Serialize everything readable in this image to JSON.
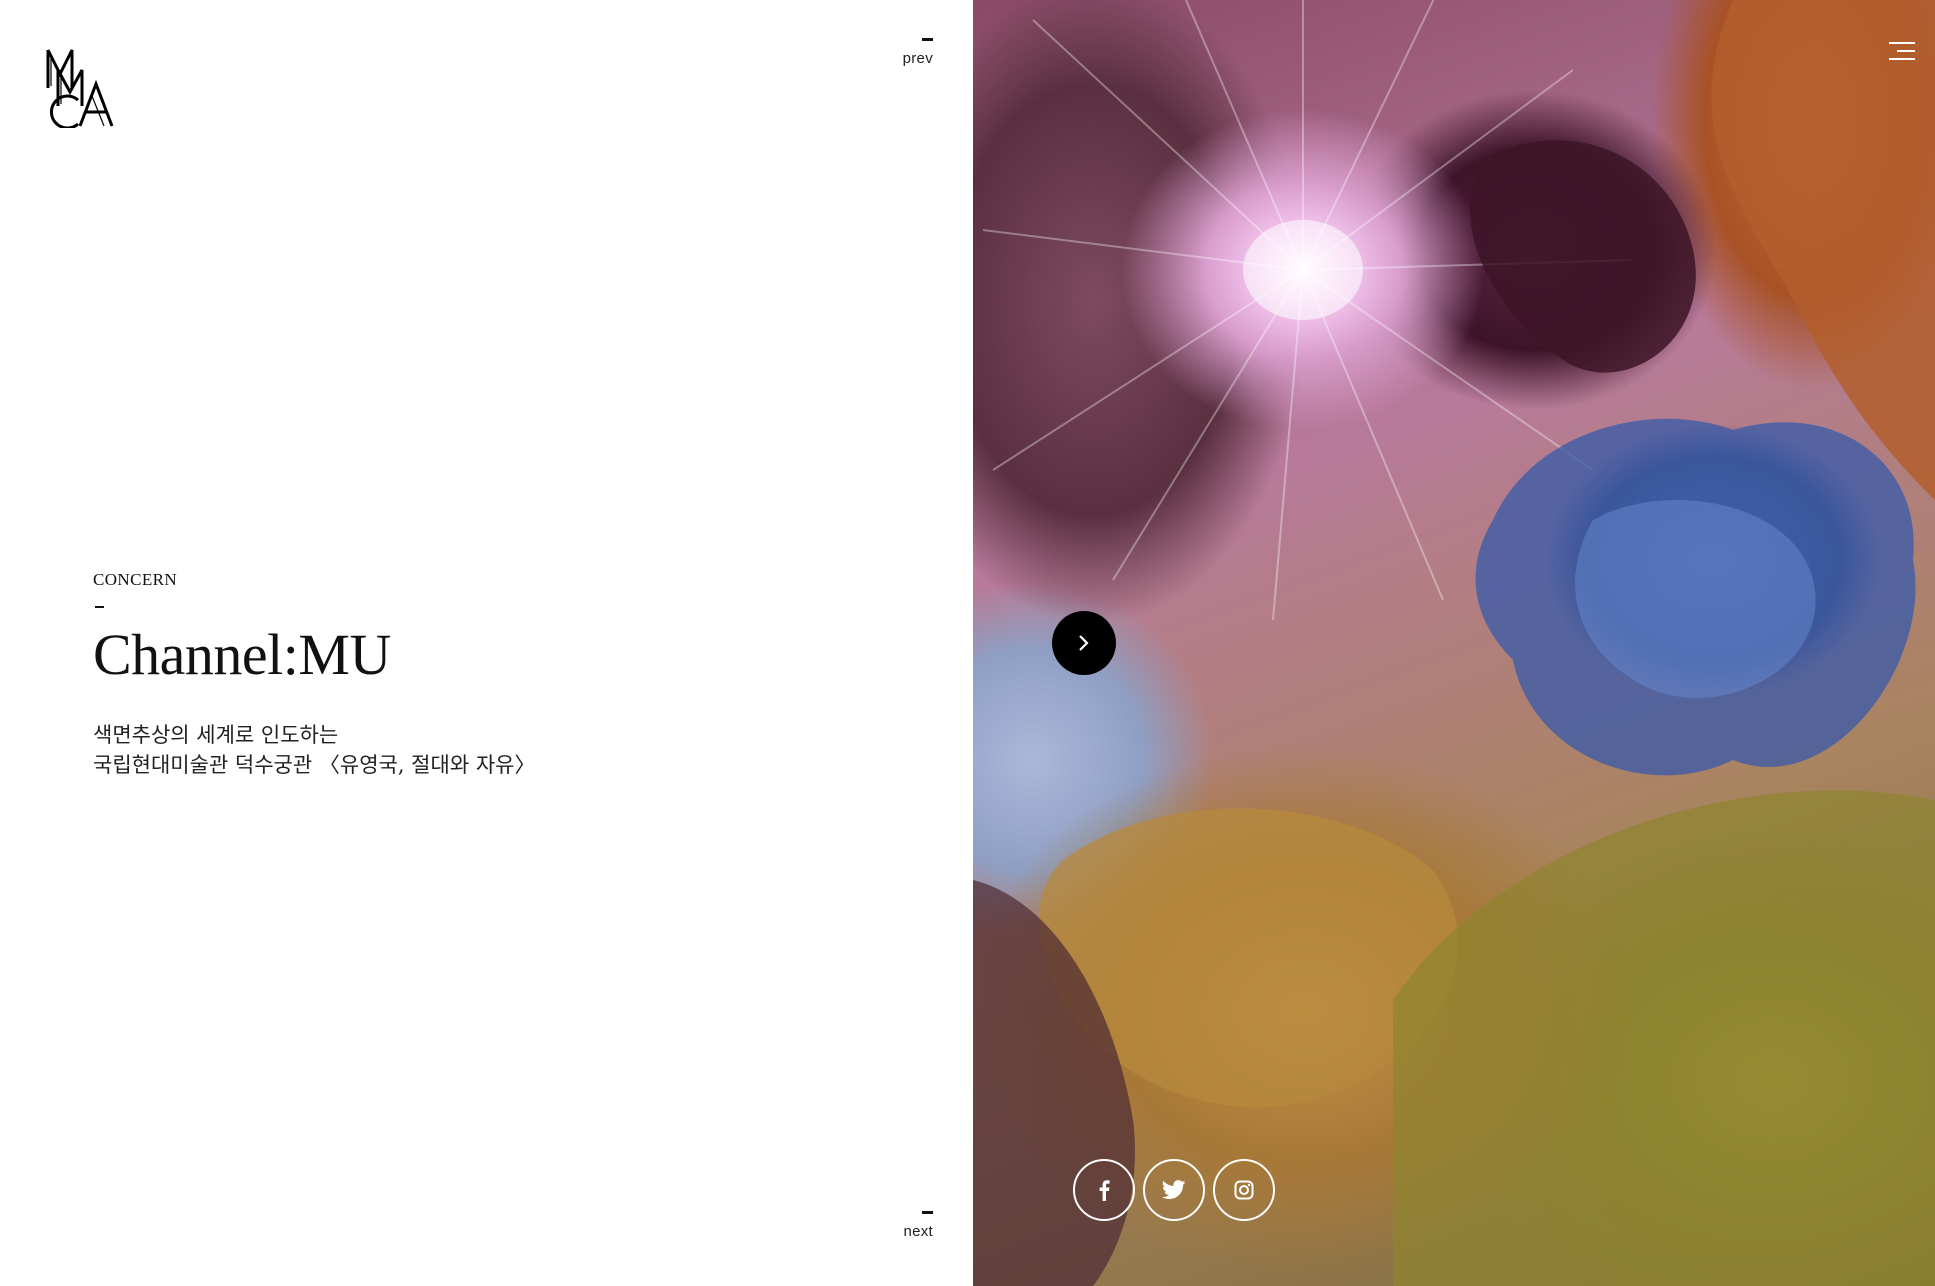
{
  "logo": {
    "text": "MMCA",
    "icon": "mmca-logo"
  },
  "nav": {
    "prev_label": "prev",
    "next_label": "next"
  },
  "article": {
    "category": "CONCERN",
    "title": "Channel:MU",
    "description_lines": [
      "색면추상의 세계로 인도하는",
      "국립현대미술관 덕수궁관 〈유영국, 절대와 자유〉"
    ]
  },
  "controls": {
    "menu_icon": "hamburger-menu-icon",
    "next_slide_icon": "chevron-right-icon"
  },
  "social": [
    {
      "name": "facebook",
      "icon": "facebook-icon"
    },
    {
      "name": "twitter",
      "icon": "twitter-icon"
    },
    {
      "name": "instagram",
      "icon": "instagram-icon"
    }
  ],
  "colors": {
    "text": "#111111",
    "background": "#ffffff",
    "button": "#000000"
  }
}
